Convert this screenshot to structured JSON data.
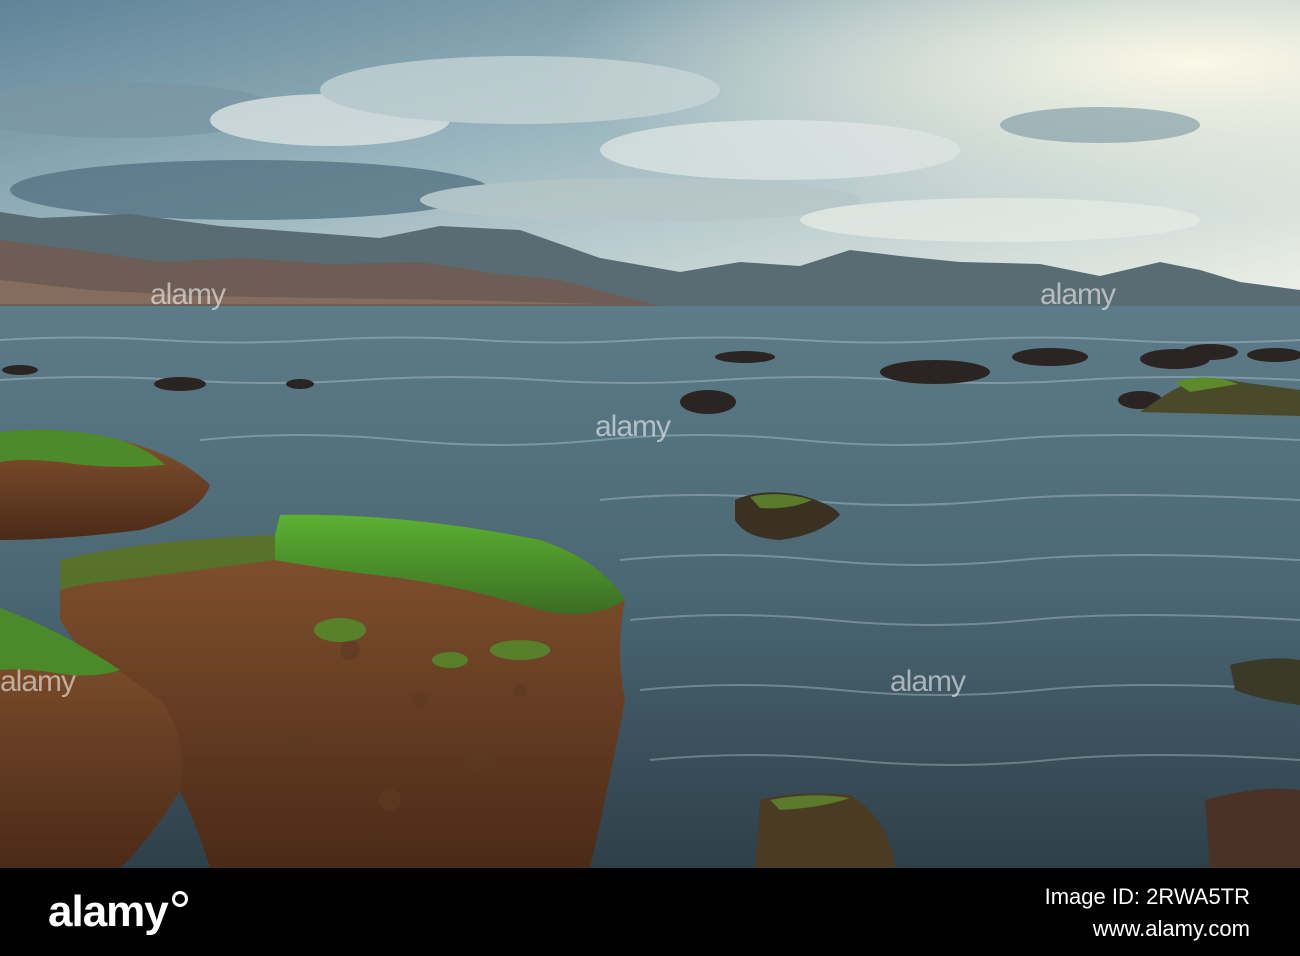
{
  "watermark": {
    "brand": "alamy",
    "image_id_label": "Image ID: 2RWA5TR",
    "site": "www.alamy.com",
    "overlay_text": "alamy"
  },
  "scene": {
    "sky_colors": [
      "#5d7f93",
      "#a9c6d2",
      "#e9eee9"
    ],
    "sea_color": "#4a6876",
    "moss_color": "#4f9a2c",
    "rock_color": "#7b4a2c"
  }
}
